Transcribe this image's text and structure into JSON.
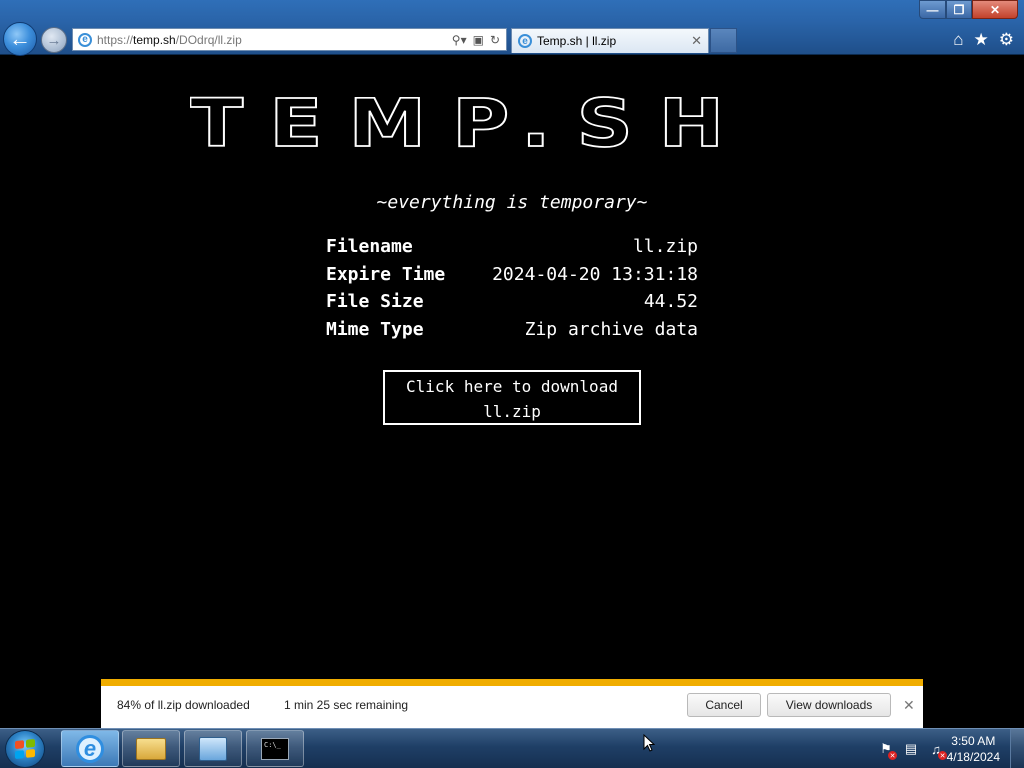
{
  "browser": {
    "address": {
      "scheme": "https://",
      "domain": "temp.sh",
      "path": "/DOdrq/ll.zip"
    },
    "tab": {
      "title": "Temp.sh | ll.zip"
    },
    "icons": {
      "back": "back-arrow-icon",
      "forward": "forward-arrow-icon",
      "search": "search-icon",
      "compat": "compatibility-view-icon",
      "refresh": "refresh-icon",
      "home": "home-icon",
      "favorites": "star-icon",
      "tools": "gear-icon"
    }
  },
  "page": {
    "logo": "TEMP.SH",
    "tagline": "~everything is temporary~",
    "info": [
      {
        "key": "Filename",
        "value": "ll.zip"
      },
      {
        "key": "Expire Time",
        "value": "2024-04-20 13:31:18"
      },
      {
        "key": "File Size",
        "value": "44.52"
      },
      {
        "key": "Mime Type",
        "value": "Zip archive data"
      }
    ],
    "download_line1": "Click here to download",
    "download_line2": "ll.zip"
  },
  "download_bar": {
    "status": "84% of ll.zip downloaded",
    "progress_percent": 84,
    "remaining": "1 min 25 sec remaining",
    "cancel_label": "Cancel",
    "view_label": "View downloads",
    "accent_color": "#f0ad00"
  },
  "taskbar": {
    "time": "3:50 AM",
    "date": "4/18/2024",
    "cmd_prompt_glyph": "C:\\_"
  }
}
